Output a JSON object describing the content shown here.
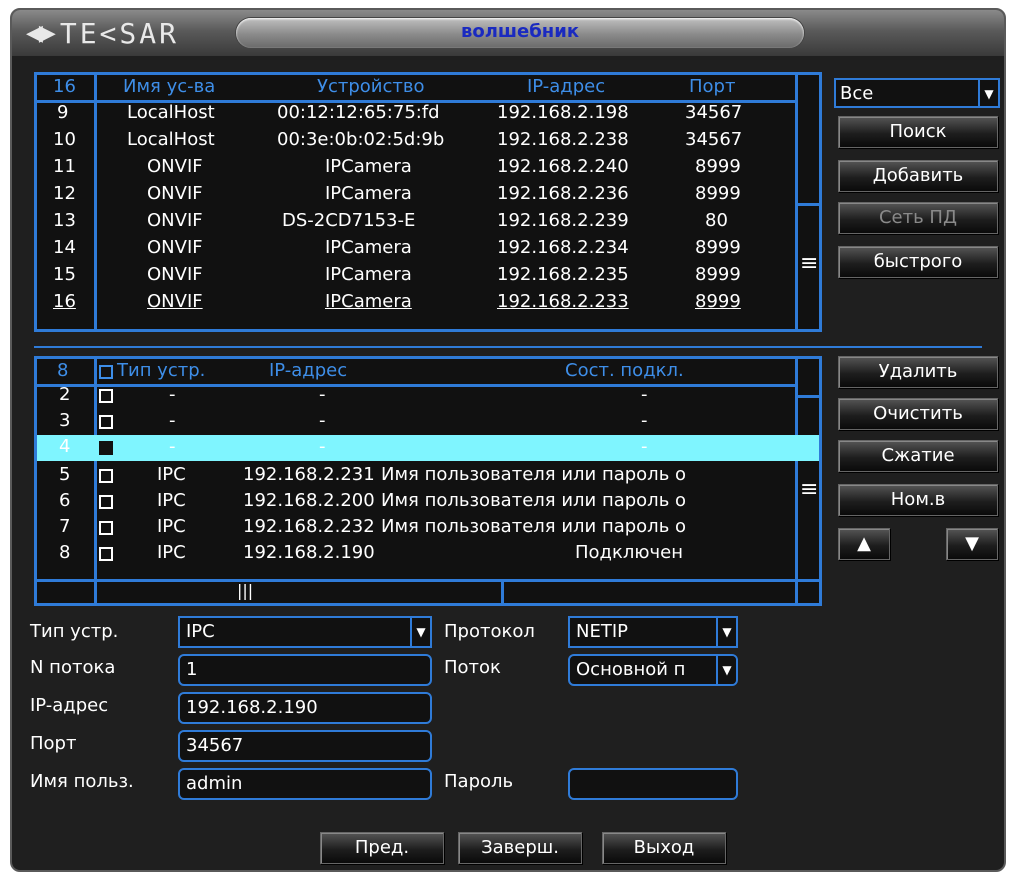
{
  "window": {
    "title": "волшебник",
    "logo": "TE<SAR"
  },
  "search_table": {
    "headers": {
      "count": "16",
      "name": "Имя ус-ва",
      "device": "Устройство",
      "ip": "IP-адрес",
      "port": "Порт"
    },
    "rows": [
      {
        "num": "9",
        "name": "LocalHost",
        "device": "00:12:12:65:75:fd",
        "ip": "192.168.2.198",
        "port": "34567"
      },
      {
        "num": "10",
        "name": "LocalHost",
        "device": "00:3e:0b:02:5d:9b",
        "ip": "192.168.2.238",
        "port": "34567"
      },
      {
        "num": "11",
        "name": "ONVIF",
        "device": "IPCamera",
        "ip": "192.168.2.240",
        "port": "8999"
      },
      {
        "num": "12",
        "name": "ONVIF",
        "device": "IPCamera",
        "ip": "192.168.2.236",
        "port": "8999"
      },
      {
        "num": "13",
        "name": "ONVIF",
        "device": "DS-2CD7153-E",
        "ip": "192.168.2.239",
        "port": "80"
      },
      {
        "num": "14",
        "name": "ONVIF",
        "device": "IPCamera",
        "ip": "192.168.2.234",
        "port": "8999"
      },
      {
        "num": "15",
        "name": "ONVIF",
        "device": "IPCamera",
        "ip": "192.168.2.235",
        "port": "8999"
      },
      {
        "num": "16",
        "name": "ONVIF",
        "device": "IPCamera",
        "ip": "192.168.2.233",
        "port": "8999"
      }
    ]
  },
  "filter_select": {
    "value": "Все"
  },
  "buttons_top": {
    "search": "Поиск",
    "add": "Добавить",
    "network": "Сеть ПД",
    "quick": "быстрого"
  },
  "added_table": {
    "headers": {
      "count": "8",
      "type": "Тип устр.",
      "ip": "IP-адрес",
      "status": "Сост. подкл."
    },
    "rows": [
      {
        "num": "2",
        "type": "-",
        "ip": "-",
        "status": "-"
      },
      {
        "num": "3",
        "type": "-",
        "ip": "-",
        "status": "-"
      },
      {
        "num": "4",
        "type": "-",
        "ip": "-",
        "status": "-",
        "selected": true
      },
      {
        "num": "5",
        "type": "IPC",
        "ip": "192.168.2.231",
        "status": "Имя пользователя или пароль о"
      },
      {
        "num": "6",
        "type": "IPC",
        "ip": "192.168.2.200",
        "status": "Имя пользователя или пароль о"
      },
      {
        "num": "7",
        "type": "IPC",
        "ip": "192.168.2.232",
        "status": "Имя пользователя или пароль о"
      },
      {
        "num": "8",
        "type": "IPC",
        "ip": "192.168.2.190",
        "status": "Подключен"
      }
    ]
  },
  "buttons_mid": {
    "delete": "Удалить",
    "clear": "Очистить",
    "compress": "Сжатие",
    "number": "Ном.в"
  },
  "form": {
    "type_label": "Тип устр.",
    "type_value": "IPC",
    "protocol_label": "Протокол",
    "protocol_value": "NETIP",
    "stream_no_label": "N потока",
    "stream_no_value": "1",
    "stream_label": "Поток",
    "stream_value": "Основной п",
    "ip_label": "IP-адрес",
    "ip_value": "192.168.2.190",
    "port_label": "Порт",
    "port_value": "34567",
    "user_label": "Имя польз.",
    "user_value": "admin",
    "password_label": "Пароль",
    "password_value": ""
  },
  "footer": {
    "prev": "Пред.",
    "finish": "Заверш.",
    "exit": "Выход"
  },
  "colors": {
    "accent": "#2f7bd8",
    "title_text": "#1a2ac0",
    "selected_row": "#7ff5ff"
  }
}
